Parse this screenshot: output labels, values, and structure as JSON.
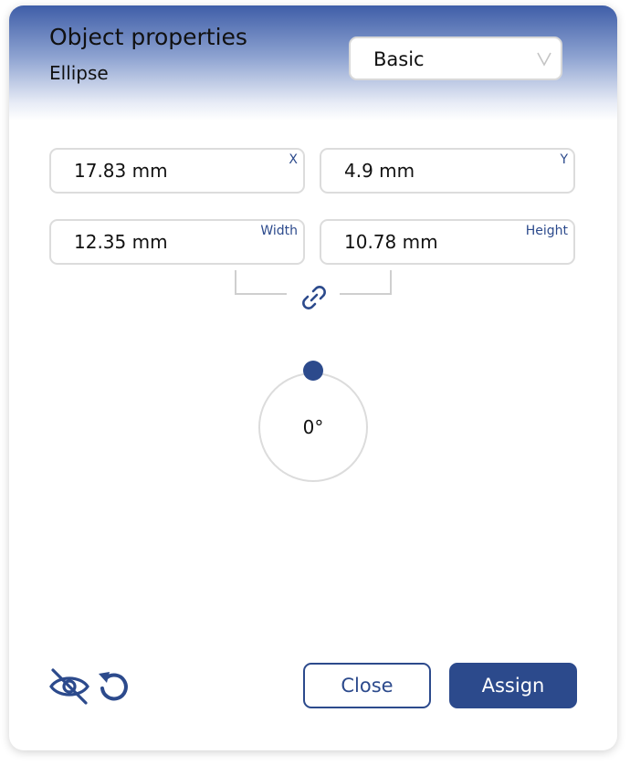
{
  "header": {
    "title": "Object properties",
    "subtitle": "Ellipse"
  },
  "mode_select": {
    "value": "Basic",
    "icon": "chevron-down-icon"
  },
  "fields": {
    "x": {
      "label": "X",
      "value": "17.83 mm"
    },
    "y": {
      "label": "Y",
      "value": "4.9 mm"
    },
    "width": {
      "label": "Width",
      "value": "12.35 mm"
    },
    "height": {
      "label": "Height",
      "value": "10.78 mm"
    }
  },
  "aspect_link": {
    "icon": "link-icon"
  },
  "rotation": {
    "value": "0°"
  },
  "footer": {
    "hide_icon": "eye-off-icon",
    "reset_icon": "reset-icon",
    "close_label": "Close",
    "assign_label": "Assign"
  },
  "colors": {
    "accent": "#2c4a8c",
    "header_top": "#3f5ea8",
    "border": "#dcdcdc"
  }
}
